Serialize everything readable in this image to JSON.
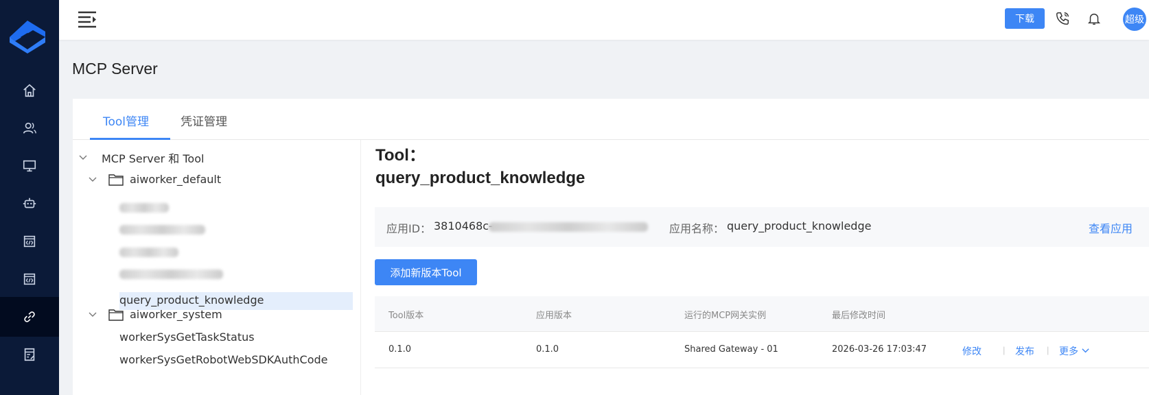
{
  "header": {
    "download_label": "下载",
    "avatar_text": "超级"
  },
  "page": {
    "title": "MCP Server"
  },
  "tabs": [
    {
      "label": "Tool管理",
      "active": true
    },
    {
      "label": "凭证管理",
      "active": false
    }
  ],
  "tree": {
    "root": "MCP Server 和 Tool",
    "groups": [
      {
        "name": "aiworker_default",
        "tools": [
          "",
          "",
          "",
          "",
          "query_product_knowledge"
        ]
      },
      {
        "name": "aiworker_system",
        "tools": [
          "workerSysGetTaskStatus",
          "workerSysGetRobotWebSDKAuthCode"
        ]
      }
    ],
    "selected": "query_product_knowledge"
  },
  "detail": {
    "heading_prefix": "Tool：",
    "heading_name": "query_product_knowledge",
    "app_id_label": "应用ID：",
    "app_id_value": "3810468c-",
    "app_name_label": "应用名称：",
    "app_name_value": "query_product_knowledge",
    "view_app_link": "查看应用",
    "add_button": "添加新版本Tool"
  },
  "table": {
    "columns": [
      "Tool版本",
      "应用版本",
      "运行的MCP网关实例",
      "最后修改时间"
    ],
    "rows": [
      {
        "tool_version": "0.1.0",
        "app_version": "0.1.0",
        "gateway": "Shared Gateway - 01",
        "modified": "2026-03-26 17:03:47",
        "actions": {
          "edit": "修改",
          "publish": "发布",
          "more": "更多"
        }
      }
    ]
  },
  "colors": {
    "sidebar_bg": "#0b1a38",
    "accent": "#3d86f5"
  }
}
